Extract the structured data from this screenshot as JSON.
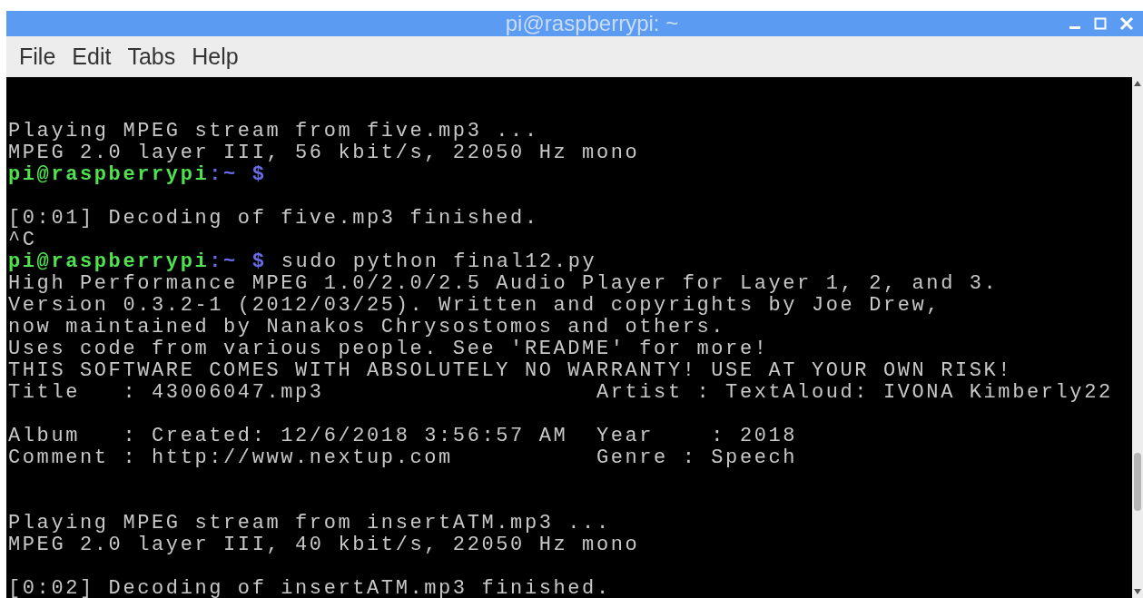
{
  "window": {
    "title": "pi@raspberrypi: ~"
  },
  "menu": [
    "File",
    "Edit",
    "Tabs",
    "Help"
  ],
  "terminal": {
    "lines": [
      {
        "kind": "blank"
      },
      {
        "kind": "blank"
      },
      {
        "kind": "output",
        "text": "Playing MPEG stream from five.mp3 ..."
      },
      {
        "kind": "output",
        "text": "MPEG 2.0 layer III, 56 kbit/s, 22050 Hz mono"
      },
      {
        "kind": "prompt",
        "user": "pi@raspberrypi",
        "path": ":~",
        "symbol": "$"
      },
      {
        "kind": "blank"
      },
      {
        "kind": "output",
        "text": "[0:01] Decoding of five.mp3 finished."
      },
      {
        "kind": "output",
        "text": "^C"
      },
      {
        "kind": "prompt",
        "user": "pi@raspberrypi",
        "path": ":~",
        "symbol": "$",
        "command": "sudo python final12.py"
      },
      {
        "kind": "output",
        "text": "High Performance MPEG 1.0/2.0/2.5 Audio Player for Layer 1, 2, and 3."
      },
      {
        "kind": "output",
        "text": "Version 0.3.2-1 (2012/03/25). Written and copyrights by Joe Drew,"
      },
      {
        "kind": "output",
        "text": "now maintained by Nanakos Chrysostomos and others."
      },
      {
        "kind": "output",
        "text": "Uses code from various people. See 'README' for more!"
      },
      {
        "kind": "output",
        "text": "THIS SOFTWARE COMES WITH ABSOLUTELY NO WARRANTY! USE AT YOUR OWN RISK!"
      },
      {
        "kind": "output",
        "text": "Title   : 43006047.mp3                   Artist : TextAloud: IVONA Kimberly22"
      },
      {
        "kind": "blank"
      },
      {
        "kind": "output",
        "text": "Album   : Created: 12/6/2018 3:56:57 AM  Year    : 2018"
      },
      {
        "kind": "output",
        "text": "Comment : http://www.nextup.com          Genre : Speech"
      },
      {
        "kind": "blank"
      },
      {
        "kind": "blank"
      },
      {
        "kind": "output",
        "text": "Playing MPEG stream from insertATM.mp3 ..."
      },
      {
        "kind": "output",
        "text": "MPEG 2.0 layer III, 40 kbit/s, 22050 Hz mono"
      },
      {
        "kind": "blank"
      },
      {
        "kind": "output",
        "text": "[0:02] Decoding of insertATM.mp3 finished."
      }
    ]
  }
}
